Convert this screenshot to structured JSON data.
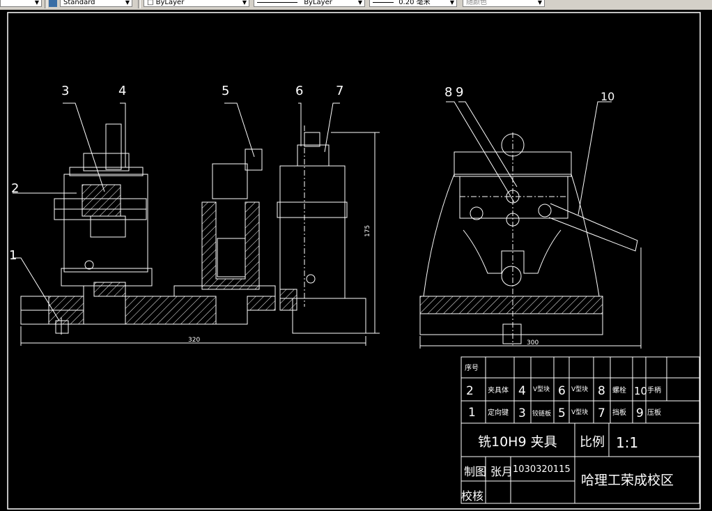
{
  "toolbar": {
    "text_style": "Standard",
    "layer": "ByLayer",
    "linetype": "ByLayer",
    "lineweight": "0.20 毫米",
    "color": "随颜色"
  },
  "drawing": {
    "part_numbers": [
      "1",
      "2",
      "3",
      "4",
      "5",
      "6",
      "7",
      "8",
      "9",
      "10"
    ],
    "dimensions": {
      "left_width": "320",
      "left_height": "175",
      "right_width": "300"
    }
  },
  "title_block": {
    "header": "序号",
    "items_row1": [
      {
        "num": "2",
        "name": "夹具体"
      },
      {
        "num": "4",
        "name": "V型块"
      },
      {
        "num": "6",
        "name": "V型块"
      },
      {
        "num": "8",
        "name": "螺栓"
      },
      {
        "num": "10",
        "name": "手柄"
      }
    ],
    "items_row2": [
      {
        "num": "1",
        "name": "定向键"
      },
      {
        "num": "3",
        "name": "铰链板"
      },
      {
        "num": "5",
        "name": "V型块"
      },
      {
        "num": "7",
        "name": "挡板"
      },
      {
        "num": "9",
        "name": "压板"
      }
    ],
    "title": "铣10H9 夹具",
    "scale_label": "比例",
    "scale_value": "1:1",
    "drawn_label": "制图",
    "drawn_name": "张月",
    "drawn_id": "1030320115",
    "school": "哈理工荣成校区",
    "checked_label": "校核"
  },
  "colors": {
    "background": "#000000",
    "lines": "#ffffff",
    "toolbar": "#d4d0c8"
  }
}
